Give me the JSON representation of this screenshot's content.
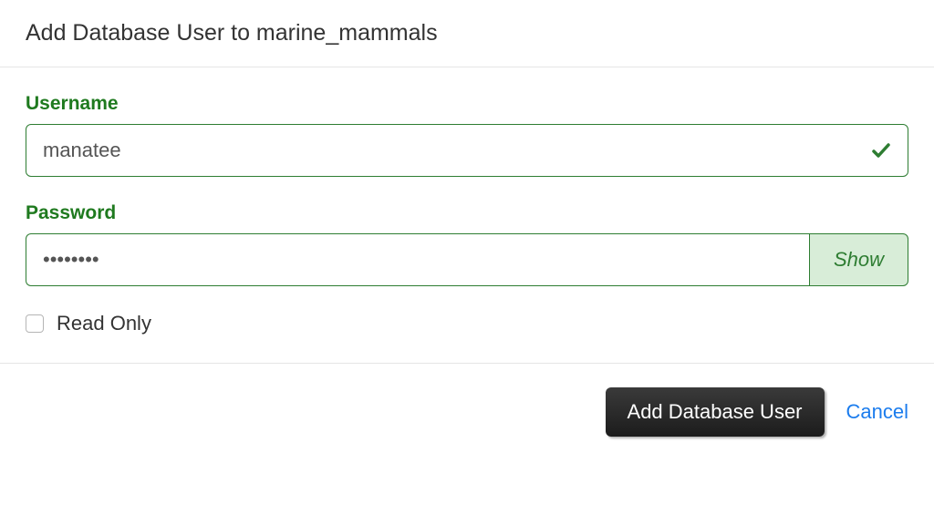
{
  "modal": {
    "title": "Add Database User to marine_mammals"
  },
  "form": {
    "username": {
      "label": "Username",
      "value": "manatee",
      "valid": true
    },
    "password": {
      "label": "Password",
      "value": "••••••••",
      "show_toggle": "Show"
    },
    "readonly": {
      "label": "Read Only",
      "checked": false
    }
  },
  "actions": {
    "submit": "Add Database User",
    "cancel": "Cancel"
  },
  "colors": {
    "accent_green": "#2e7d32",
    "link_blue": "#1b7ced",
    "button_dark": "#2a2a2a"
  }
}
